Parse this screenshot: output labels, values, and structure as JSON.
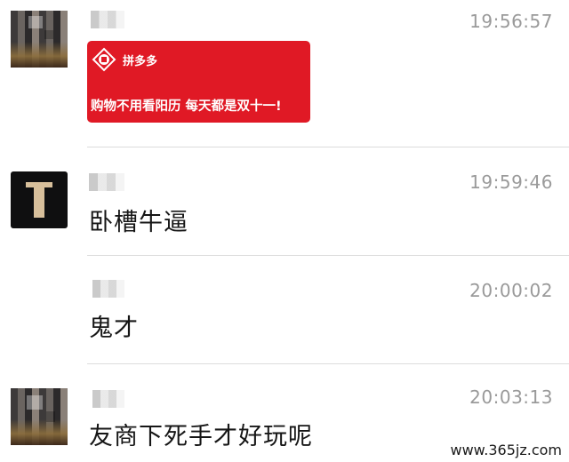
{
  "messages": [
    {
      "time": "19:56:57",
      "ad": {
        "brand": "拼多多",
        "slogan": "购物不用看阳历   每天都是双十一!"
      }
    },
    {
      "time": "19:59:46",
      "text": "卧槽牛逼"
    },
    {
      "time": "20:00:02",
      "text": "鬼才"
    },
    {
      "time": "20:03:13",
      "text": "友商下死手才好玩呢"
    }
  ],
  "watermark": "www.365jz.com",
  "colors": {
    "ad_red": "#e01925",
    "time_gray": "#9a9a9a",
    "divider": "#dcdcdc"
  }
}
